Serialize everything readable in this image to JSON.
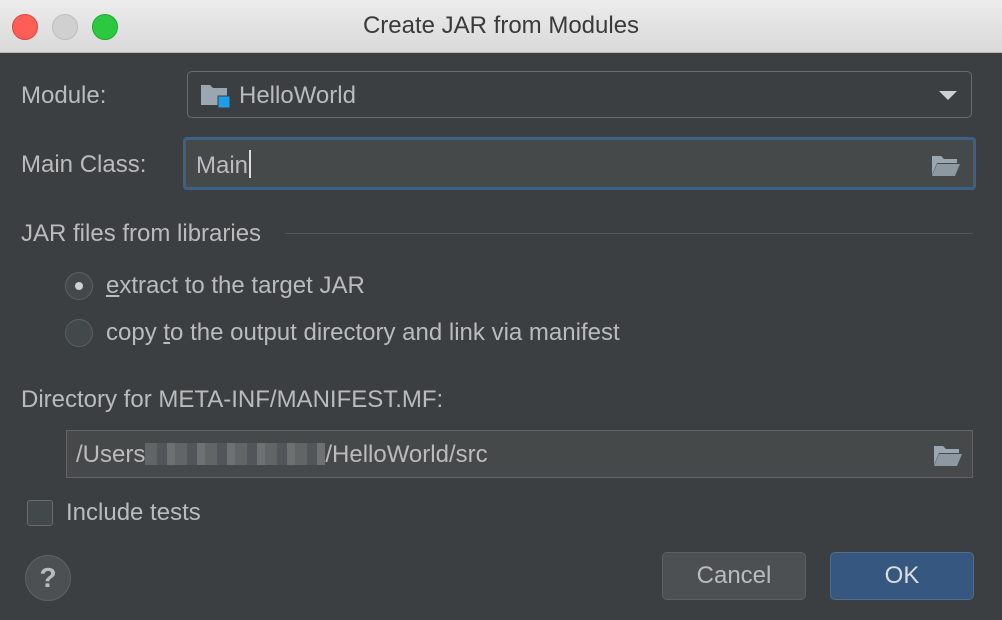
{
  "window": {
    "title": "Create JAR from Modules"
  },
  "module": {
    "label": "Module:",
    "value": "HelloWorld"
  },
  "main_class": {
    "label": "Main Class:",
    "value": "Main"
  },
  "libraries": {
    "section_title": "JAR files from libraries",
    "option_extract": {
      "mnemonic": "e",
      "rest": "xtract to the target JAR",
      "selected": true
    },
    "option_copy": {
      "before": "copy ",
      "mnemonic": "t",
      "after": "o the output directory and link via manifest",
      "selected": false
    }
  },
  "manifest": {
    "label": "Directory for META-INF/MANIFEST.MF:",
    "path_prefix": "/Users",
    "path_suffix": "/HelloWorld/src"
  },
  "include_tests": {
    "label": "Include tests",
    "checked": false
  },
  "help": {
    "glyph": "?"
  },
  "buttons": {
    "cancel": "Cancel",
    "ok": "OK"
  },
  "colors": {
    "background": "#3c3f41",
    "accent": "#365880",
    "focus": "#3d6185",
    "module_badge": "#1e9ee8"
  },
  "icons": {
    "module": "module-folder-icon",
    "browse": "folder-open-icon",
    "dropdown": "chevron-down-icon"
  }
}
